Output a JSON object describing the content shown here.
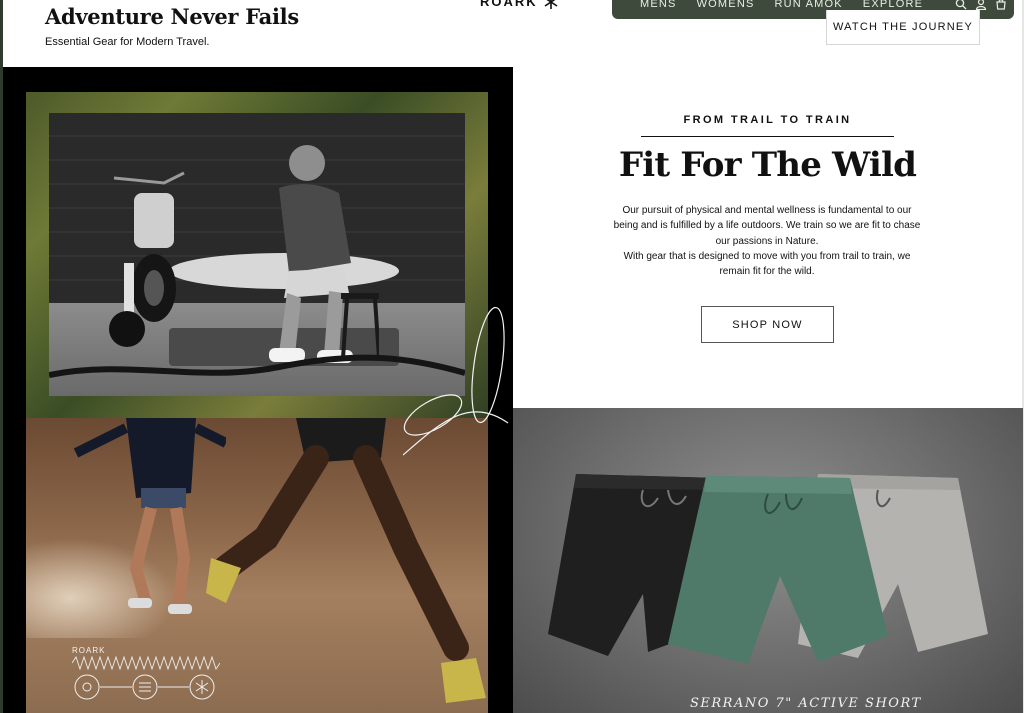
{
  "header": {
    "title": "Adventure Never Fails",
    "subtitle": "Essential Gear for Modern Travel.",
    "logo_text": "ROARK"
  },
  "nav": {
    "items": [
      "MENS",
      "WOMENS",
      "RUN AMOK",
      "EXPLORE"
    ],
    "icons": [
      "search-icon",
      "account-icon",
      "cart-icon"
    ],
    "watch_label": "WATCH THE JOURNEY"
  },
  "hero": {
    "eyebrow": "FROM TRAIL TO TRAIN",
    "headline": "Fit For The Wild",
    "body_line1": "Our pursuit of physical and mental wellness is fundamental to our being and is fulfilled by a life outdoors. We train so we are fit to chase our passions in Nature.",
    "body_line2": "With gear that is designed to move with you from trail to train, we remain fit for the wild.",
    "cta": "SHOP NOW"
  },
  "collage": {
    "stamp_label": "ROARK"
  },
  "product": {
    "caption": "SERRANO 7\" ACTIVE SHORT"
  },
  "colors": {
    "nav_bg": "#3d4a3c",
    "short_green": "#4f7a6a",
    "short_black": "#1f1f1f",
    "short_grey": "#b5b3b0"
  }
}
